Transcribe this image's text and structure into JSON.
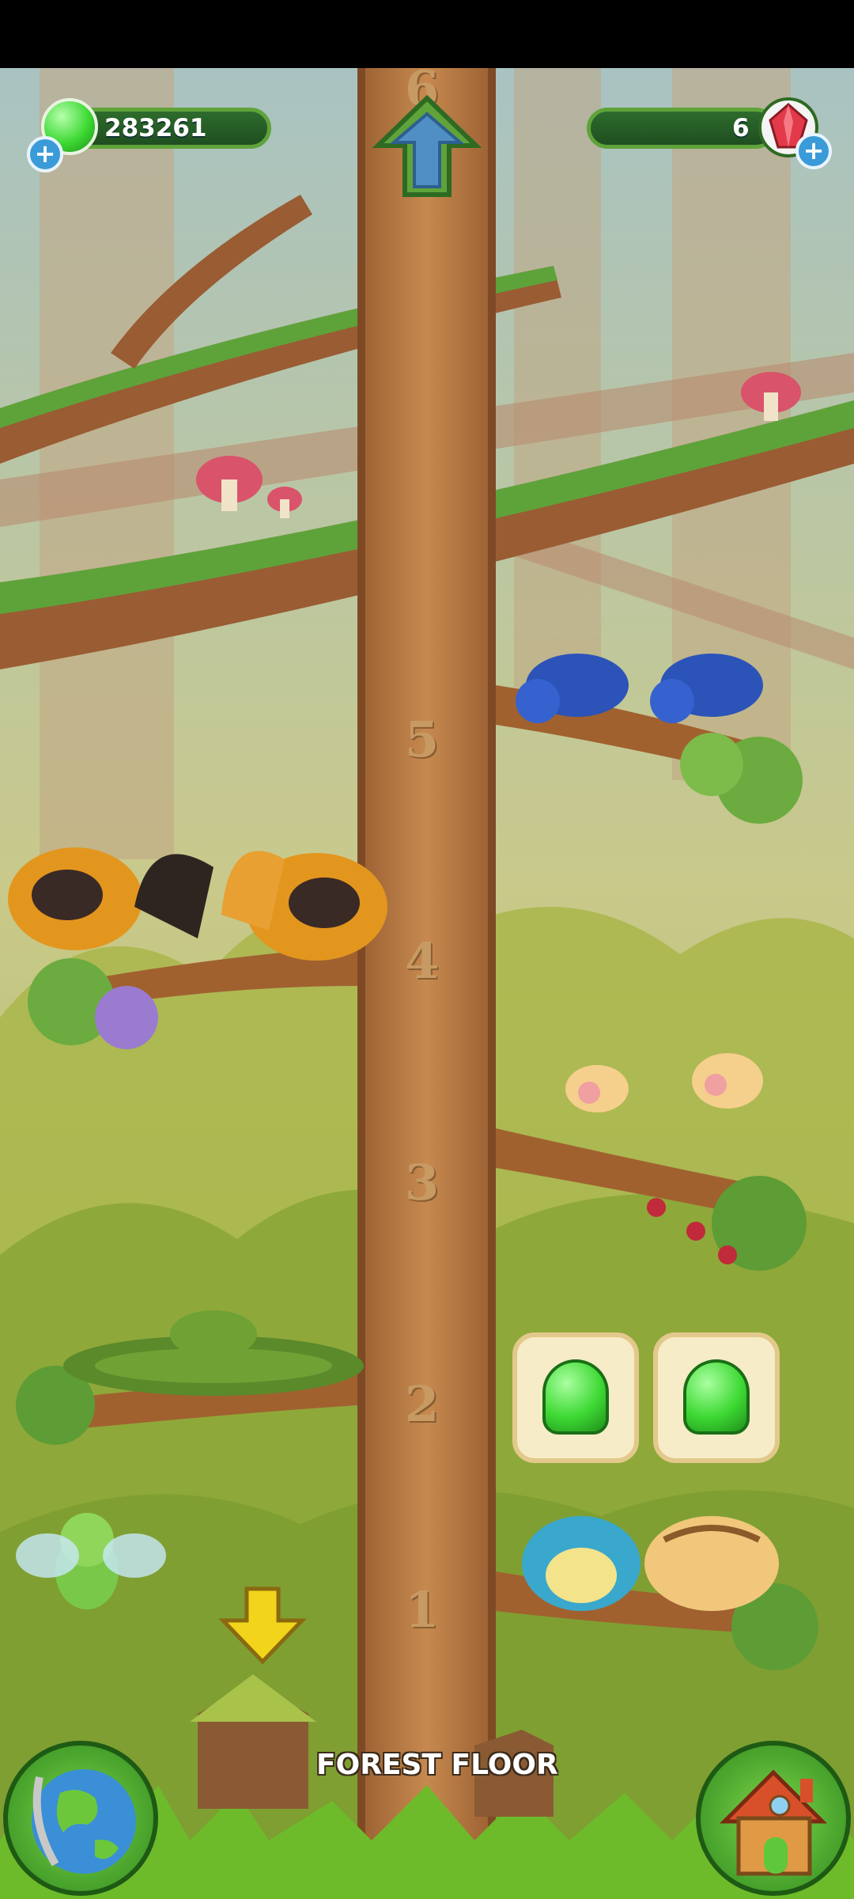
{
  "hud": {
    "slime_count": "283261",
    "gem_count": "6",
    "add_slime_label": "+",
    "add_gem_label": "+"
  },
  "tree": {
    "levels": [
      "1",
      "2",
      "3",
      "4",
      "5",
      "6"
    ],
    "floor_label": "FOREST FLOOR"
  },
  "colors": {
    "trunk": "#b87a45",
    "hud_bar": "#2d6b2c",
    "slime": "#3ed934",
    "gem": "#e23a4a",
    "arrow": "#f2d51b"
  },
  "icons": {
    "slime": "slime-icon",
    "gem": "gem-icon",
    "up": "up-arrow-icon",
    "down": "down-arrow-icon",
    "globe": "globe-icon",
    "house": "house-icon"
  }
}
